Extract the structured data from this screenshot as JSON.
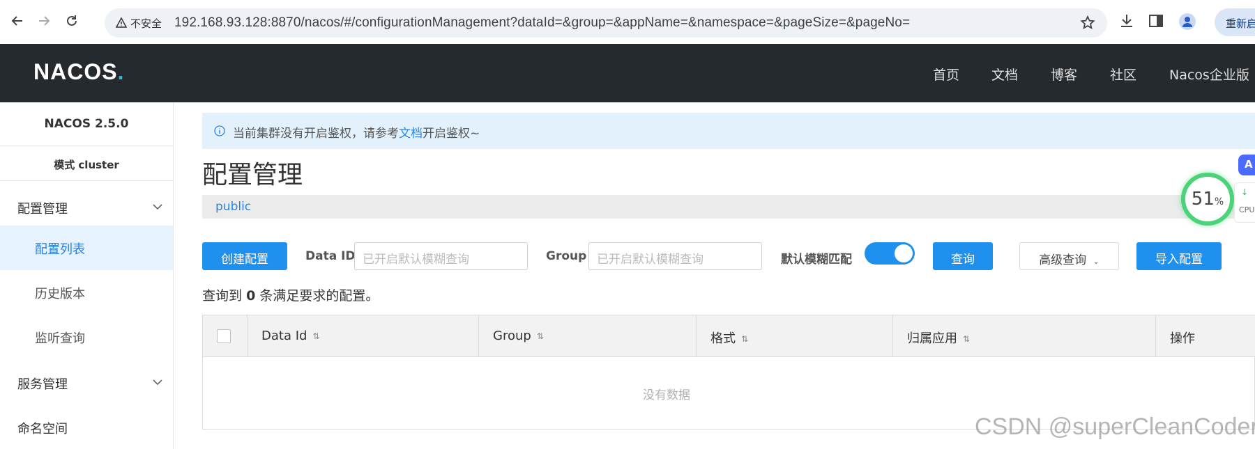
{
  "browser": {
    "security_label": "不安全",
    "url": "192.168.93.128:8870/nacos/#/configurationManagement?dataId=&group=&appName=&namespace=&pageSize=&pageNo=",
    "relaunch_label": "重新启"
  },
  "header": {
    "logo": "NACOS",
    "nav": [
      "首页",
      "文档",
      "博客",
      "社区",
      "Nacos企业版"
    ]
  },
  "sidebar": {
    "version": "NACOS 2.5.0",
    "mode": "模式 cluster",
    "groups": [
      {
        "label": "配置管理",
        "items": [
          "配置列表",
          "历史版本",
          "监听查询"
        ],
        "active_item": "配置列表"
      },
      {
        "label": "服务管理"
      },
      {
        "label": "命名空间"
      }
    ]
  },
  "notice": {
    "prefix": "当前集群没有开启鉴权，请参考",
    "link": "文档",
    "suffix": "开启鉴权~"
  },
  "page": {
    "title": "配置管理",
    "namespace": "public"
  },
  "toolbar": {
    "create_label": "创建配置",
    "dataid_label": "Data ID",
    "dataid_placeholder": "已开启默认模糊查询",
    "group_label": "Group",
    "group_placeholder": "已开启默认模糊查询",
    "fuzzy_label": "默认模糊匹配",
    "fuzzy_enabled": true,
    "query_label": "查询",
    "advanced_label": "高级查询",
    "import_label": "导入配置"
  },
  "result": {
    "prefix": "查询到",
    "count": "0",
    "suffix": "条满足要求的配置。"
  },
  "table": {
    "columns": [
      "Data Id",
      "Group",
      "格式",
      "归属应用",
      "操作"
    ],
    "empty_text": "没有数据",
    "rows": []
  },
  "widgets": {
    "cpu_value": "51",
    "cpu_unit": "%",
    "cpu_label": "CPU",
    "ai_badge": "A"
  },
  "watermark": "CSDN @superCleanCoder",
  "colors": {
    "primary": "#1f90ee",
    "header_bg": "#252a2f",
    "active_menu_bg": "#e6f3ff",
    "notice_bg": "#e3f1fd"
  }
}
